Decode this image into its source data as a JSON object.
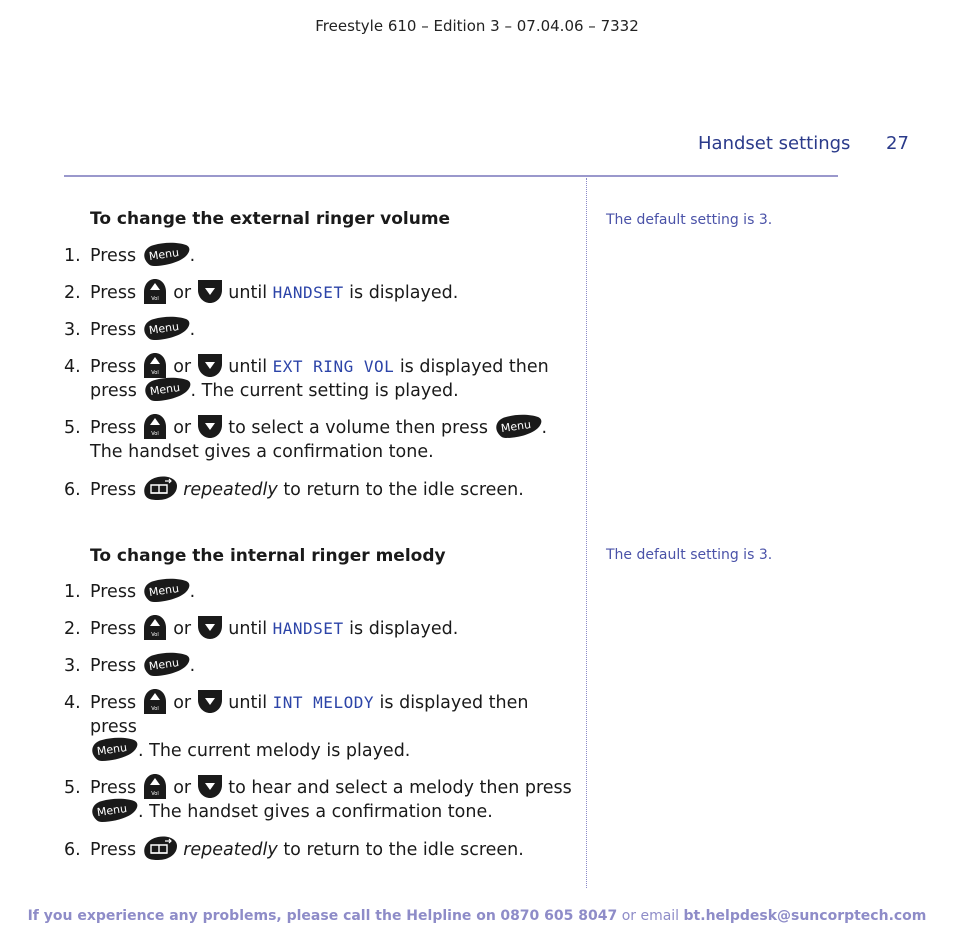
{
  "doc_id": "Freestyle 610 – Edition 3 – 07.04.06 – 7332",
  "header": {
    "section_title": "Handset settings",
    "page_number": "27"
  },
  "colors": {
    "accent_text": "#2a3a8a",
    "lcd_text": "#2c44a8",
    "rule": "#9a98cc",
    "footer_text": "#8e8cc8",
    "key_fill": "#1a1a1a"
  },
  "icons": {
    "menu_key": "menu-key-icon",
    "vol_up_key": "volume-up-key-icon",
    "down_key": "down-arrow-key-icon",
    "phonebook_key": "phonebook-back-key-icon"
  },
  "key_labels": {
    "menu": "Menu",
    "vol": "Vol"
  },
  "sections": [
    {
      "heading": "To change the external ringer volume",
      "side_note": "The default setting is 3.",
      "steps": [
        {
          "num": "1.",
          "parts": [
            "Press",
            "."
          ]
        },
        {
          "num": "2.",
          "parts": [
            "Press",
            "or",
            "until",
            "HANDSET",
            "is displayed."
          ]
        },
        {
          "num": "3.",
          "parts": [
            "Press",
            "."
          ]
        },
        {
          "num": "4.",
          "parts": [
            "Press",
            "or",
            "until",
            "EXT RING VOL",
            "is displayed then press",
            ". The current setting is played."
          ]
        },
        {
          "num": "5.",
          "parts": [
            "Press",
            "or",
            "to select a volume then press",
            ".",
            "The handset gives a confirmation tone."
          ]
        },
        {
          "num": "6.",
          "parts": [
            "Press",
            "repeatedly",
            "to return to the idle screen."
          ]
        }
      ]
    },
    {
      "heading": "To change the internal ringer melody",
      "side_note": "The default setting is 3.",
      "steps": [
        {
          "num": "1.",
          "parts": [
            "Press",
            "."
          ]
        },
        {
          "num": "2.",
          "parts": [
            "Press",
            "or",
            "until",
            "HANDSET",
            "is displayed."
          ]
        },
        {
          "num": "3.",
          "parts": [
            "Press",
            "."
          ]
        },
        {
          "num": "4.",
          "parts": [
            "Press",
            "or",
            "until",
            "INT MELODY",
            "is displayed then press",
            ". The current melody is played."
          ]
        },
        {
          "num": "5.",
          "parts": [
            "Press",
            "or",
            "to hear and select a melody then press",
            ". The handset gives a confirmation tone."
          ]
        },
        {
          "num": "6.",
          "parts": [
            "Press",
            "repeatedly",
            "to return to the idle screen."
          ]
        }
      ]
    }
  ],
  "footer": {
    "lead": "If you experience any problems, please call the Helpline on",
    "phone": "0870 605 8047",
    "middle": "or email",
    "email": "bt.helpdesk@suncorptech.com"
  }
}
